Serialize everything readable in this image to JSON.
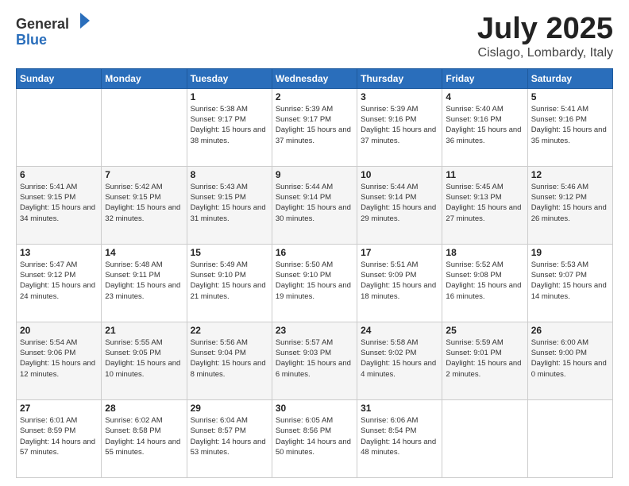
{
  "logo": {
    "general": "General",
    "blue": "Blue"
  },
  "title": "July 2025",
  "location": "Cislago, Lombardy, Italy",
  "days_of_week": [
    "Sunday",
    "Monday",
    "Tuesday",
    "Wednesday",
    "Thursday",
    "Friday",
    "Saturday"
  ],
  "weeks": [
    [
      null,
      null,
      {
        "day": 1,
        "sunrise": "5:38 AM",
        "sunset": "9:17 PM",
        "daylight": "15 hours and 38 minutes."
      },
      {
        "day": 2,
        "sunrise": "5:39 AM",
        "sunset": "9:17 PM",
        "daylight": "15 hours and 37 minutes."
      },
      {
        "day": 3,
        "sunrise": "5:39 AM",
        "sunset": "9:16 PM",
        "daylight": "15 hours and 37 minutes."
      },
      {
        "day": 4,
        "sunrise": "5:40 AM",
        "sunset": "9:16 PM",
        "daylight": "15 hours and 36 minutes."
      },
      {
        "day": 5,
        "sunrise": "5:41 AM",
        "sunset": "9:16 PM",
        "daylight": "15 hours and 35 minutes."
      }
    ],
    [
      {
        "day": 6,
        "sunrise": "5:41 AM",
        "sunset": "9:15 PM",
        "daylight": "15 hours and 34 minutes."
      },
      {
        "day": 7,
        "sunrise": "5:42 AM",
        "sunset": "9:15 PM",
        "daylight": "15 hours and 32 minutes."
      },
      {
        "day": 8,
        "sunrise": "5:43 AM",
        "sunset": "9:15 PM",
        "daylight": "15 hours and 31 minutes."
      },
      {
        "day": 9,
        "sunrise": "5:44 AM",
        "sunset": "9:14 PM",
        "daylight": "15 hours and 30 minutes."
      },
      {
        "day": 10,
        "sunrise": "5:44 AM",
        "sunset": "9:14 PM",
        "daylight": "15 hours and 29 minutes."
      },
      {
        "day": 11,
        "sunrise": "5:45 AM",
        "sunset": "9:13 PM",
        "daylight": "15 hours and 27 minutes."
      },
      {
        "day": 12,
        "sunrise": "5:46 AM",
        "sunset": "9:12 PM",
        "daylight": "15 hours and 26 minutes."
      }
    ],
    [
      {
        "day": 13,
        "sunrise": "5:47 AM",
        "sunset": "9:12 PM",
        "daylight": "15 hours and 24 minutes."
      },
      {
        "day": 14,
        "sunrise": "5:48 AM",
        "sunset": "9:11 PM",
        "daylight": "15 hours and 23 minutes."
      },
      {
        "day": 15,
        "sunrise": "5:49 AM",
        "sunset": "9:10 PM",
        "daylight": "15 hours and 21 minutes."
      },
      {
        "day": 16,
        "sunrise": "5:50 AM",
        "sunset": "9:10 PM",
        "daylight": "15 hours and 19 minutes."
      },
      {
        "day": 17,
        "sunrise": "5:51 AM",
        "sunset": "9:09 PM",
        "daylight": "15 hours and 18 minutes."
      },
      {
        "day": 18,
        "sunrise": "5:52 AM",
        "sunset": "9:08 PM",
        "daylight": "15 hours and 16 minutes."
      },
      {
        "day": 19,
        "sunrise": "5:53 AM",
        "sunset": "9:07 PM",
        "daylight": "15 hours and 14 minutes."
      }
    ],
    [
      {
        "day": 20,
        "sunrise": "5:54 AM",
        "sunset": "9:06 PM",
        "daylight": "15 hours and 12 minutes."
      },
      {
        "day": 21,
        "sunrise": "5:55 AM",
        "sunset": "9:05 PM",
        "daylight": "15 hours and 10 minutes."
      },
      {
        "day": 22,
        "sunrise": "5:56 AM",
        "sunset": "9:04 PM",
        "daylight": "15 hours and 8 minutes."
      },
      {
        "day": 23,
        "sunrise": "5:57 AM",
        "sunset": "9:03 PM",
        "daylight": "15 hours and 6 minutes."
      },
      {
        "day": 24,
        "sunrise": "5:58 AM",
        "sunset": "9:02 PM",
        "daylight": "15 hours and 4 minutes."
      },
      {
        "day": 25,
        "sunrise": "5:59 AM",
        "sunset": "9:01 PM",
        "daylight": "15 hours and 2 minutes."
      },
      {
        "day": 26,
        "sunrise": "6:00 AM",
        "sunset": "9:00 PM",
        "daylight": "15 hours and 0 minutes."
      }
    ],
    [
      {
        "day": 27,
        "sunrise": "6:01 AM",
        "sunset": "8:59 PM",
        "daylight": "14 hours and 57 minutes."
      },
      {
        "day": 28,
        "sunrise": "6:02 AM",
        "sunset": "8:58 PM",
        "daylight": "14 hours and 55 minutes."
      },
      {
        "day": 29,
        "sunrise": "6:04 AM",
        "sunset": "8:57 PM",
        "daylight": "14 hours and 53 minutes."
      },
      {
        "day": 30,
        "sunrise": "6:05 AM",
        "sunset": "8:56 PM",
        "daylight": "14 hours and 50 minutes."
      },
      {
        "day": 31,
        "sunrise": "6:06 AM",
        "sunset": "8:54 PM",
        "daylight": "14 hours and 48 minutes."
      },
      null,
      null
    ]
  ]
}
